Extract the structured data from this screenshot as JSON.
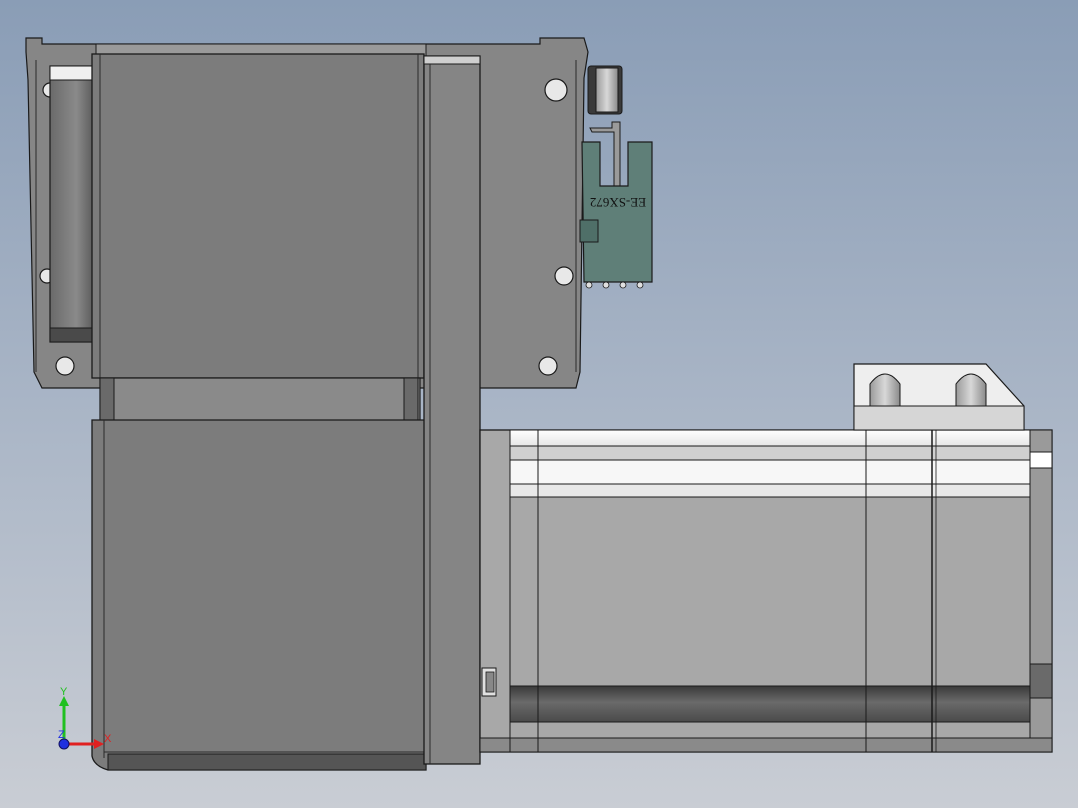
{
  "viewport": {
    "background_top": "#8a9db6",
    "background_bottom": "#c9cdd4"
  },
  "model": {
    "sensor_label": "EE-SX672",
    "part_colors": {
      "body_dark": "#7c7c7c",
      "body_mid": "#8a8a8a",
      "motor_gray": "#a8a8a8",
      "sensor_teal": "#5f7f78",
      "edge": "#1a1a1a",
      "highlight": "#f2f2f2"
    }
  },
  "triad": {
    "x_label": "X",
    "y_label": "Y",
    "z_label": "Z",
    "x_color": "#e02020",
    "y_color": "#20c020",
    "z_color": "#2030e0"
  }
}
